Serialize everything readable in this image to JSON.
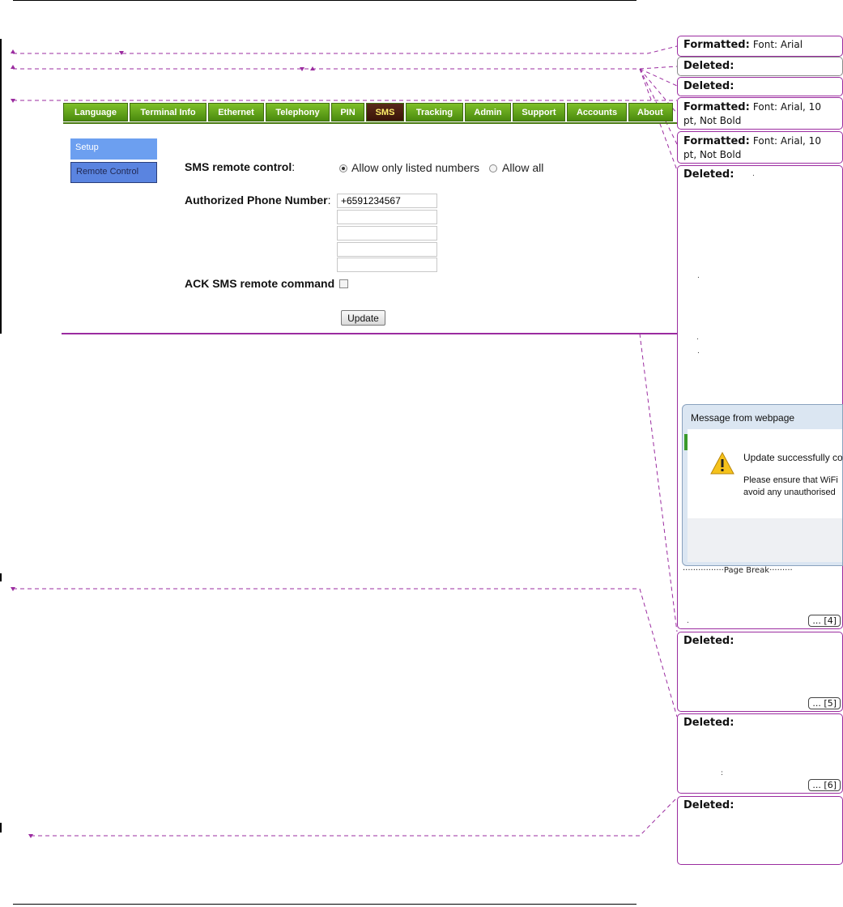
{
  "nav": {
    "tabs": [
      {
        "label": "Language",
        "active": false
      },
      {
        "label": "Terminal Info",
        "active": false
      },
      {
        "label": "Ethernet",
        "active": false
      },
      {
        "label": "Telephony",
        "active": false
      },
      {
        "label": "PIN",
        "active": false
      },
      {
        "label": "SMS",
        "active": true
      },
      {
        "label": "Tracking",
        "active": false
      },
      {
        "label": "Admin",
        "active": false
      },
      {
        "label": "Support",
        "active": false
      },
      {
        "label": "Accounts",
        "active": false
      },
      {
        "label": "About",
        "active": false
      }
    ]
  },
  "sidebar": {
    "items": [
      {
        "label": "Setup"
      },
      {
        "label": "Remote Control"
      }
    ]
  },
  "form": {
    "sms_label": "SMS remote control",
    "colon": ":",
    "radio_options": [
      {
        "label": "Allow only listed numbers",
        "checked": true
      },
      {
        "label": "Allow all",
        "checked": false
      }
    ],
    "auth_label": "Authorized Phone Number",
    "phone_numbers": [
      "+6591234567",
      "",
      "",
      "",
      ""
    ],
    "ack_label": "ACK SMS remote command",
    "ack_checked": false,
    "update_button": "Update"
  },
  "comments": {
    "c1": {
      "kind": "Formatted:",
      "text": "Font: Arial"
    },
    "c2": {
      "kind": "Deleted:"
    },
    "c3": {
      "kind": "Deleted:"
    },
    "c4": {
      "kind": "Formatted:",
      "text": "Font: Arial, 10 pt, Not Bold"
    },
    "c5": {
      "kind": "Formatted:",
      "text": "Font: Arial, 10 pt, Not Bold"
    },
    "c6": {
      "kind": "Deleted:",
      "more": "... [4]"
    },
    "c7": {
      "kind": "Deleted:",
      "more": "... [5]"
    },
    "c8": {
      "kind": "Deleted:",
      "more": "... [6]"
    },
    "c9": {
      "kind": "Deleted:"
    }
  },
  "dialog": {
    "title": "Message from webpage",
    "line1": "Update successfully cor",
    "line2": "Please ensure that WiFi",
    "line3": "avoid any unauthorised"
  },
  "page_break": "Page Break",
  "colors": {
    "purple": "#9b2ca0",
    "nav_green": "#5e9e16",
    "sidebar_blue": "#6c9ff0"
  }
}
